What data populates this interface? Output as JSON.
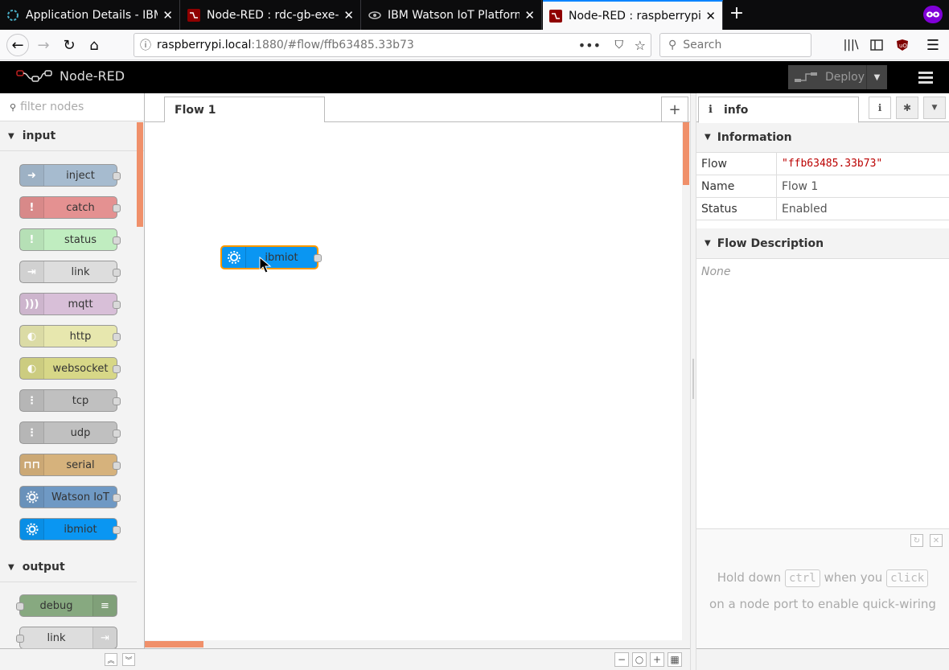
{
  "browser": {
    "tabs": [
      {
        "title": "Application Details - IBM",
        "active": false
      },
      {
        "title": "Node-RED : rdc-gb-exe-n",
        "active": false
      },
      {
        "title": "IBM Watson IoT Platform",
        "active": false
      },
      {
        "title": "Node-RED : raspberrypi.",
        "active": true
      }
    ],
    "url_host": "raspberrypi.local",
    "url_path": ":1880/#flow/ffb63485.33b73",
    "search_placeholder": "Search"
  },
  "header": {
    "app_name": "Node-RED",
    "deploy_label": "Deploy"
  },
  "palette": {
    "filter_placeholder": "filter nodes",
    "categories": [
      {
        "name": "input"
      },
      {
        "name": "output"
      }
    ],
    "input_nodes": [
      {
        "label": "inject",
        "color": "#a6bbcf"
      },
      {
        "label": "catch",
        "color": "#e49191"
      },
      {
        "label": "status",
        "color": "#c0edc0"
      },
      {
        "label": "link",
        "color": "#dddddd"
      },
      {
        "label": "mqtt",
        "color": "#d8bfd8"
      },
      {
        "label": "http",
        "color": "#e7e7ae"
      },
      {
        "label": "websocket",
        "color": "#d7d787"
      },
      {
        "label": "tcp",
        "color": "#c0c0c0"
      },
      {
        "label": "udp",
        "color": "#c0c0c0"
      },
      {
        "label": "serial",
        "color": "#d6b27c"
      },
      {
        "label": "Watson IoT",
        "color": "#6f99c4"
      },
      {
        "label": "ibmiot",
        "color": "#0a96f2"
      }
    ],
    "output_nodes": [
      {
        "label": "debug",
        "color": "#87a980"
      },
      {
        "label": "link",
        "color": "#dddddd"
      }
    ]
  },
  "workspace": {
    "flow_tab": "Flow 1",
    "canvas_node": {
      "label": "ibmiot",
      "color": "#0a96f2"
    }
  },
  "sidebar": {
    "tab_label": "info",
    "information_title": "Information",
    "rows": [
      {
        "key": "Flow",
        "value": "\"ffb63485.33b73\""
      },
      {
        "key": "Name",
        "value": "Flow 1"
      },
      {
        "key": "Status",
        "value": "Enabled"
      }
    ],
    "description_title": "Flow Description",
    "description_value": "None",
    "tip": {
      "part1": "Hold down",
      "key1": "ctrl",
      "part2": "when you",
      "key2": "click",
      "part3": "on a node port to enable quick-wiring"
    }
  }
}
